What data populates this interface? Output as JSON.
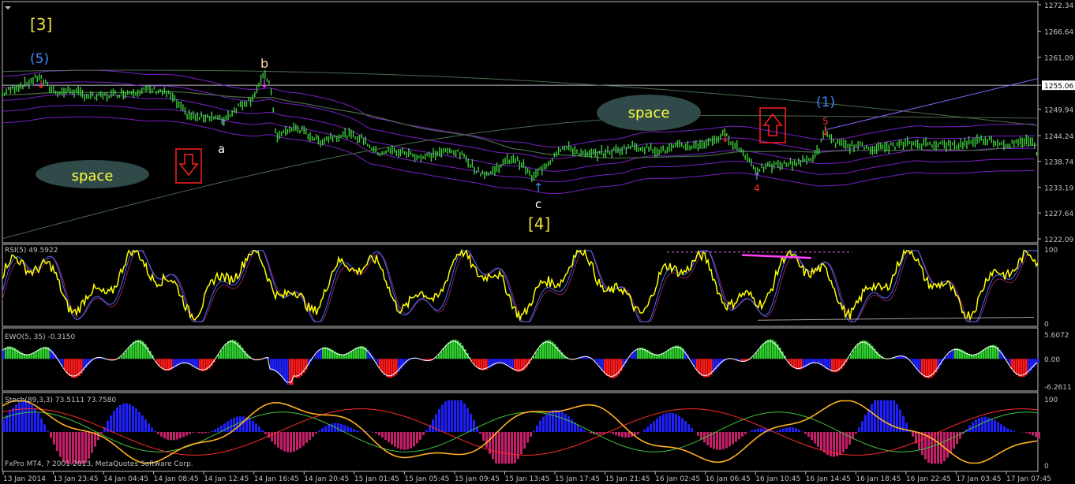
{
  "colors": {
    "background": "#000000",
    "frame": "#c0c0c0",
    "price": "#3cd23c",
    "ema_band": "#7a1fc8",
    "ema_slow": "#4a6a4a",
    "level_line": "#c0c0c0",
    "rsi_yellow": "#ffff00",
    "rsi_blue": "#4a6cff",
    "rsi_red": "#ff2020",
    "rsi_green": "#30ff30",
    "ewo_green": "#2fcf2f",
    "ewo_red": "#ff1a1a",
    "ewo_blue": "#2020ff",
    "stoch_pos": "#2020ff",
    "stoch_neg": "#c4206a",
    "stoch_orange": "#ffb020",
    "stoch_red": "#ff2a2a",
    "stoch_green": "#40c040",
    "space_ellipse": "#2f4a48",
    "annot_yellow": "#f0e040",
    "annot_blue": "#3a8cff",
    "annot_white": "#ffffff",
    "annot_pink": "#ffc8a0",
    "annot_red": "#ff3030",
    "magenta": "#ff40ff"
  },
  "chart_data": {
    "type": "line",
    "price_axis": {
      "ticks": [
        "1272.34",
        "1266.64",
        "1261.09",
        "1255.06",
        "1249.94",
        "1244.24",
        "1238.74",
        "1233.19",
        "1227.64",
        "1222.09"
      ],
      "current": "1255.06"
    },
    "time_axis": [
      "13 Jan 2014",
      "13 Jan 23:45",
      "14 Jan 04:45",
      "14 Jan 08:45",
      "14 Jan 12:45",
      "14 Jan 16:45",
      "14 Jan 20:45",
      "15 Jan 01:45",
      "15 Jan 05:45",
      "15 Jan 09:45",
      "15 Jan 13:45",
      "15 Jan 17:45",
      "15 Jan 21:45",
      "16 Jan 02:45",
      "16 Jan 06:45",
      "16 Jan 10:45",
      "16 Jan 14:45",
      "16 Jan 18:45",
      "16 Jan 22:45",
      "17 Jan 03:45",
      "17 Jan 07:45"
    ],
    "price_series": [
      [
        0,
        1253.0
      ],
      [
        18,
        1254.5
      ],
      [
        35,
        1255.5
      ],
      [
        50,
        1257.0
      ],
      [
        62,
        1254.5
      ],
      [
        75,
        1253.5
      ],
      [
        90,
        1254.0
      ],
      [
        105,
        1253.0
      ],
      [
        120,
        1252.5
      ],
      [
        140,
        1253.0
      ],
      [
        160,
        1253.5
      ],
      [
        180,
        1254.0
      ],
      [
        200,
        1254.0
      ],
      [
        215,
        1253.0
      ],
      [
        225,
        1251.0
      ],
      [
        235,
        1249.0
      ],
      [
        250,
        1248.0
      ],
      [
        265,
        1248.5
      ],
      [
        282,
        1247.5
      ],
      [
        292,
        1249.0
      ],
      [
        305,
        1251.0
      ],
      [
        318,
        1252.0
      ],
      [
        328,
        1255.0
      ],
      [
        336,
        1257.5
      ],
      [
        342,
        1255.0
      ],
      [
        347,
        1249.0
      ],
      [
        350,
        1243.5
      ],
      [
        360,
        1245.0
      ],
      [
        375,
        1246.0
      ],
      [
        390,
        1244.5
      ],
      [
        405,
        1243.0
      ],
      [
        420,
        1244.0
      ],
      [
        440,
        1244.5
      ],
      [
        460,
        1243.5
      ],
      [
        478,
        1240.5
      ],
      [
        495,
        1241.0
      ],
      [
        515,
        1240.5
      ],
      [
        535,
        1239.5
      ],
      [
        555,
        1240.5
      ],
      [
        575,
        1241.0
      ],
      [
        590,
        1239.5
      ],
      [
        605,
        1236.5
      ],
      [
        620,
        1236.0
      ],
      [
        635,
        1238.0
      ],
      [
        650,
        1239.5
      ],
      [
        662,
        1238.0
      ],
      [
        675,
        1235.0
      ],
      [
        685,
        1237.0
      ],
      [
        698,
        1239.0
      ],
      [
        708,
        1241.5
      ],
      [
        722,
        1241.5
      ],
      [
        742,
        1240.0
      ],
      [
        760,
        1240.5
      ],
      [
        780,
        1241.0
      ],
      [
        800,
        1242.0
      ],
      [
        820,
        1241.5
      ],
      [
        840,
        1241.0
      ],
      [
        860,
        1242.0
      ],
      [
        880,
        1242.0
      ],
      [
        900,
        1243.0
      ],
      [
        918,
        1244.5
      ],
      [
        930,
        1242.5
      ],
      [
        945,
        1240.0
      ],
      [
        958,
        1237.0
      ],
      [
        972,
        1237.5
      ],
      [
        990,
        1238.0
      ],
      [
        1010,
        1238.5
      ],
      [
        1025,
        1239.0
      ],
      [
        1037,
        1241.0
      ],
      [
        1046,
        1245.5
      ],
      [
        1055,
        1243.0
      ],
      [
        1070,
        1242.0
      ],
      [
        1090,
        1242.0
      ],
      [
        1110,
        1241.5
      ],
      [
        1130,
        1242.0
      ],
      [
        1150,
        1242.5
      ],
      [
        1170,
        1242.5
      ],
      [
        1190,
        1242.5
      ],
      [
        1210,
        1242.0
      ],
      [
        1230,
        1243.0
      ],
      [
        1250,
        1243.5
      ],
      [
        1270,
        1242.5
      ],
      [
        1290,
        1242.5
      ],
      [
        1300,
        1243.5
      ],
      [
        1310,
        1242.5
      ],
      [
        1315,
        1240.0
      ]
    ],
    "rsi": {
      "label": "RSI(5) 49.5922",
      "scale": [
        "100",
        "0"
      ]
    },
    "ewo": {
      "label": "EWO(5, 35) -0.3150",
      "scale": [
        "5.6072",
        "0.00",
        "-6.2611"
      ]
    },
    "stoch": {
      "label": "Stoch(89,3,3) 73.5111 73.7580",
      "scale": [
        "100",
        "0"
      ]
    },
    "footer": "FxPro MT4, ? 2001-2013, MetaQuotes Software Corp.",
    "annotations": {
      "wave3": "[3]",
      "wave4": "[4]",
      "wave5": "(5)",
      "wave1": "(1)",
      "a": "a",
      "b": "b",
      "c": "c",
      "four": "4",
      "five": "5",
      "space_left": "space",
      "space_right": "space"
    }
  }
}
